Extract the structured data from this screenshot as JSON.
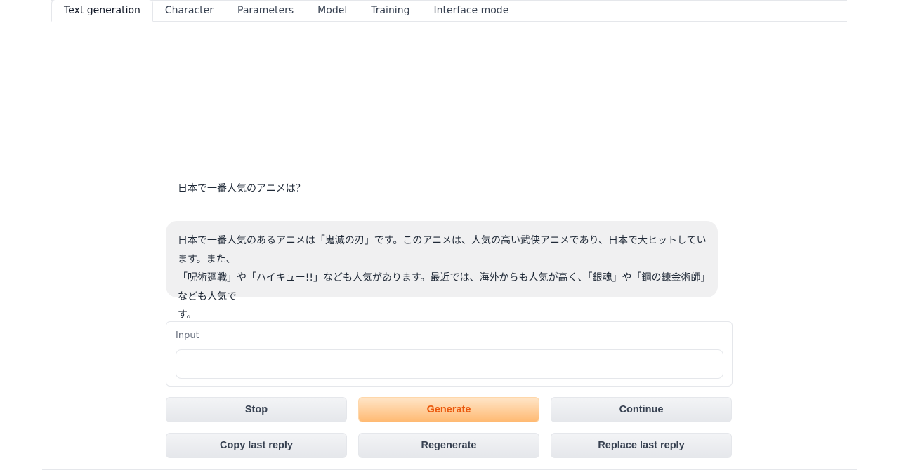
{
  "tabs": [
    {
      "label": "Text generation",
      "active": true
    },
    {
      "label": "Character"
    },
    {
      "label": "Parameters"
    },
    {
      "label": "Model"
    },
    {
      "label": "Training"
    },
    {
      "label": "Interface mode"
    }
  ],
  "chat": {
    "user_message": "日本で一番人気のアニメは？",
    "bot_reply": {
      "line1": "日本で一番人気のあるアニメは「鬼滅の刃」です。このアニメは、人気の高い武侠アニメであり、日本で大ヒットしています。また、",
      "line2": "「呪術廻戦」や「ハイキュー!!」なども人気があります。最近では、海外からも人気が高く、「銀魂」や「鋼の錬金術師」なども人気で",
      "line3": "す。"
    }
  },
  "input": {
    "label": "Input",
    "value": "",
    "placeholder": ""
  },
  "buttons": {
    "stop": "Stop",
    "generate": "Generate",
    "continue": "Continue",
    "copy_last_reply": "Copy last reply",
    "regenerate": "Regenerate",
    "replace_last_reply": "Replace last reply"
  },
  "colors": {
    "primary_text": "#ea580c",
    "primary_from": "#ffe5c7",
    "primary_to": "#ffba73",
    "bubble_bg": "#f0f0f1"
  }
}
